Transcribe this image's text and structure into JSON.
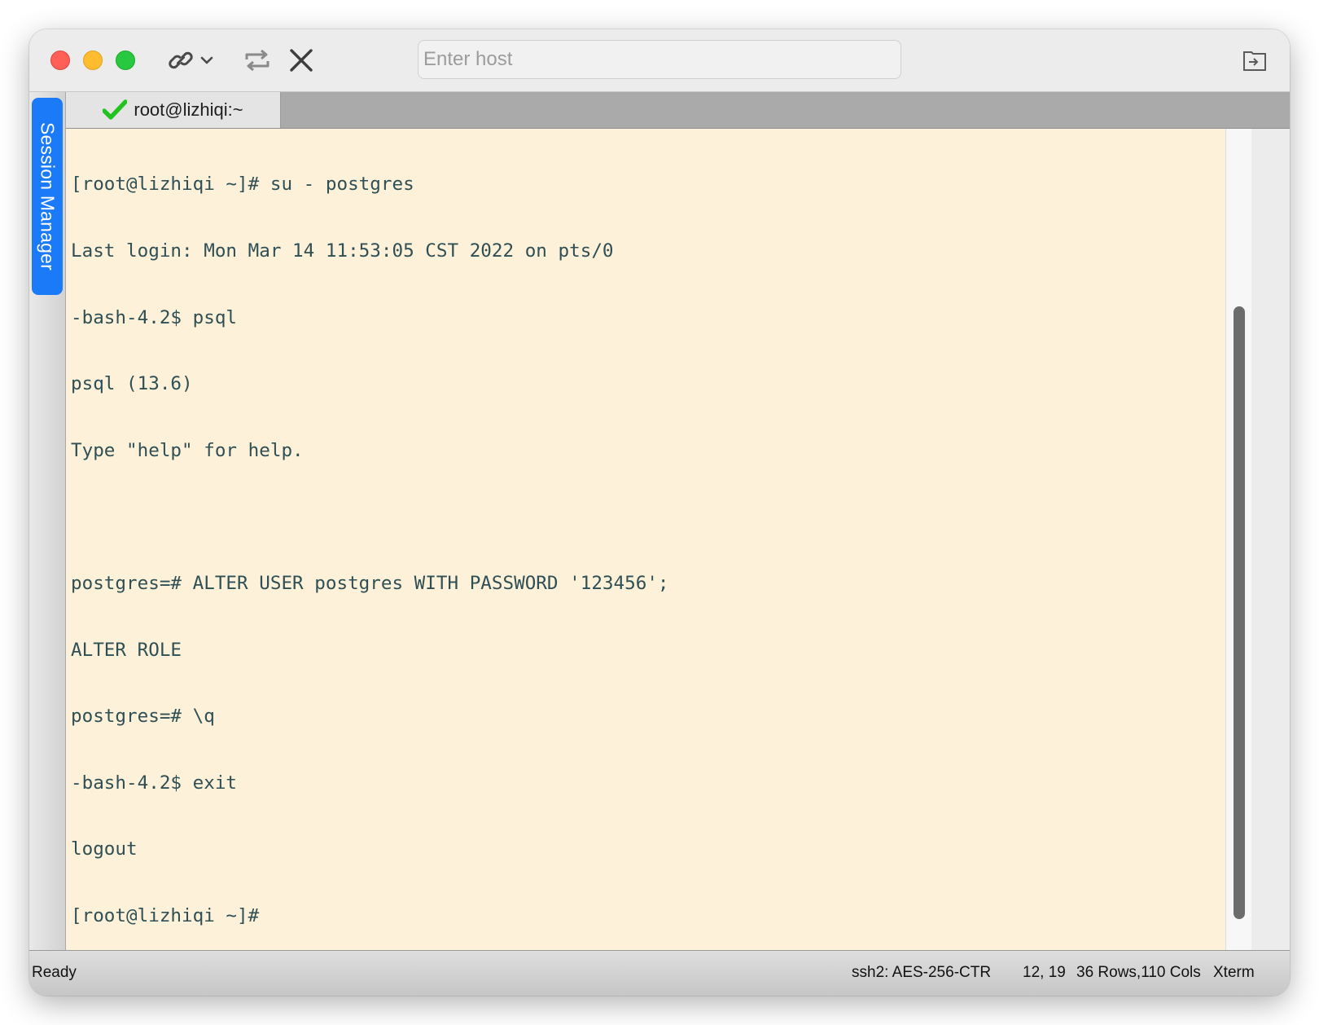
{
  "toolbar": {
    "host_placeholder": "Enter host",
    "icons": {
      "connect": "link-icon",
      "connect_menu": "chevron-down-icon",
      "reconnect": "repeat-icon",
      "disconnect": "close-icon",
      "transfer": "file-transfer-icon"
    }
  },
  "sidebar": {
    "session_manager_label": "Session Manager"
  },
  "tabs": [
    {
      "label": "root@lizhiqi:~",
      "status_icon": "checkmark-icon",
      "active": true
    }
  ],
  "terminal": {
    "lines": [
      "[root@lizhiqi ~]# su - postgres",
      "Last login: Mon Mar 14 11:53:05 CST 2022 on pts/0",
      "-bash-4.2$ psql",
      "psql (13.6)",
      "Type \"help\" for help.",
      "",
      "postgres=# ALTER USER postgres WITH PASSWORD '123456';",
      "ALTER ROLE",
      "postgres=# \\q",
      "-bash-4.2$ exit",
      "logout",
      "[root@lizhiqi ~]# "
    ]
  },
  "statusbar": {
    "status": "Ready",
    "encryption": "ssh2: AES-256-CTR",
    "cursor_position": "12, 19",
    "dimensions": "36 Rows,110 Cols",
    "terminal_type": "Xterm"
  },
  "colors": {
    "terminal_background": "#fdf2d9",
    "terminal_text": "#2f4f55",
    "session_tab": "#1a7af8",
    "check": "#22c21f"
  }
}
